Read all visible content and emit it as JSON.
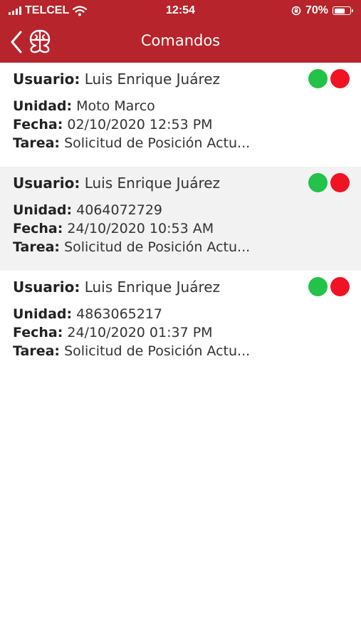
{
  "status_bar": {
    "carrier": "TELCEL",
    "time": "12:54",
    "battery": "70%",
    "battery_level": 0.7
  },
  "header": {
    "title": "Comandos"
  },
  "labels": {
    "user": "Usuario:",
    "unit": "Unidad:",
    "date": "Fecha:",
    "task": "Tarea:"
  },
  "items": [
    {
      "user": "Luis Enrique Juárez",
      "unit": "Moto Marco",
      "date": "02/10/2020 12:53 PM",
      "task": "Solicitud de Posición Actu..."
    },
    {
      "user": "Luis Enrique Juárez",
      "unit": "4064072729",
      "date": "24/10/2020 10:53 AM",
      "task": "Solicitud de Posición Actu..."
    },
    {
      "user": "Luis Enrique Juárez",
      "unit": "4863065217",
      "date": "24/10/2020 01:37 PM",
      "task": "Solicitud de Posición Actu..."
    }
  ],
  "colors": {
    "brand": "#b7242b",
    "status_ok": "#22c24b",
    "status_error": "#f01324",
    "alt_row": "#f2f2f2"
  },
  "icons": [
    "signal-icon",
    "wifi-icon",
    "orientation-lock-icon",
    "battery-icon",
    "back-chevron-icon",
    "app-logo-icon"
  ]
}
